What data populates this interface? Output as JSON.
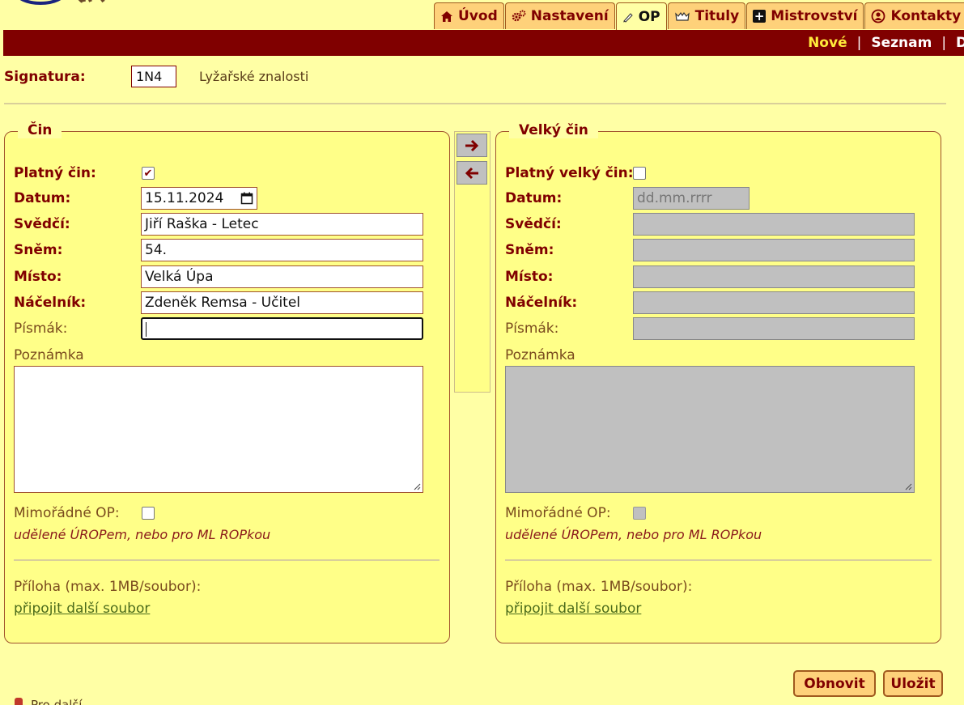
{
  "nav": {
    "tabs": [
      {
        "label": "Úvod",
        "icon": "home-icon"
      },
      {
        "label": "Nastavení",
        "icon": "gears-icon"
      },
      {
        "label": "OP",
        "icon": "pen-icon"
      },
      {
        "label": "Tituly",
        "icon": "crown-icon"
      },
      {
        "label": "Mistrovství",
        "icon": "plus-box-icon"
      },
      {
        "label": "Kontakty",
        "icon": "user-circle-icon"
      }
    ],
    "active_tab": "OP"
  },
  "subnav": {
    "items": [
      "Nové",
      "Seznam",
      "Dl"
    ],
    "current": "Nové"
  },
  "signatura": {
    "label": "Signatura:",
    "value": "1N4",
    "description": "Lyžařské znalosti"
  },
  "cin": {
    "legend": "Čin",
    "platny_label": "Platný čin:",
    "platny_checked": true,
    "datum_label": "Datum:",
    "datum_value": "15.11.2024",
    "svedci_label": "Svědčí:",
    "svedci_value": "Jiří Raška - Letec",
    "snem_label": "Sněm:",
    "snem_value": "54.",
    "misto_label": "Místo:",
    "misto_value": "Velká Úpa",
    "nacelnik_label": "Náčelník:",
    "nacelnik_value": "Zdeněk Remsa - Učitel",
    "pismak_label": "Písmák:",
    "pismak_value": "",
    "poznamka_label": "Poznámka",
    "mimoradne_label": "Mimořádné OP:",
    "mimoradne_checked": false,
    "mimoradne_note": "udělené ÚROPem, nebo pro ML ROPkou",
    "priloha_label": "Příloha (max. 1MB/soubor):",
    "priloha_link": "připojit další soubor"
  },
  "velky_cin": {
    "legend": "Velký čin",
    "platny_label": "Platný velký čin:",
    "platny_checked": false,
    "datum_label": "Datum:",
    "datum_placeholder": "dd.mm.rrrr",
    "svedci_label": "Svědčí:",
    "snem_label": "Sněm:",
    "misto_label": "Místo:",
    "nacelnik_label": "Náčelník:",
    "pismak_label": "Písmák:",
    "poznamka_label": "Poznámka",
    "mimoradne_label": "Mimořádné OP:",
    "mimoradne_note": "udělené ÚROPem, nebo pro ML ROPkou",
    "priloha_label": "Příloha (max. 1MB/soubor):",
    "priloha_link": "připojit další soubor"
  },
  "arrows": {
    "right": "➔",
    "left": "🡐"
  },
  "buttons": {
    "obnovit": "Obnovit",
    "ulozit": "Uložit"
  },
  "footer_text": "Pro další …",
  "colors": {
    "background": "#ffffa5",
    "bar": "#800000",
    "accent": "#fed17a",
    "text": "#800000"
  }
}
